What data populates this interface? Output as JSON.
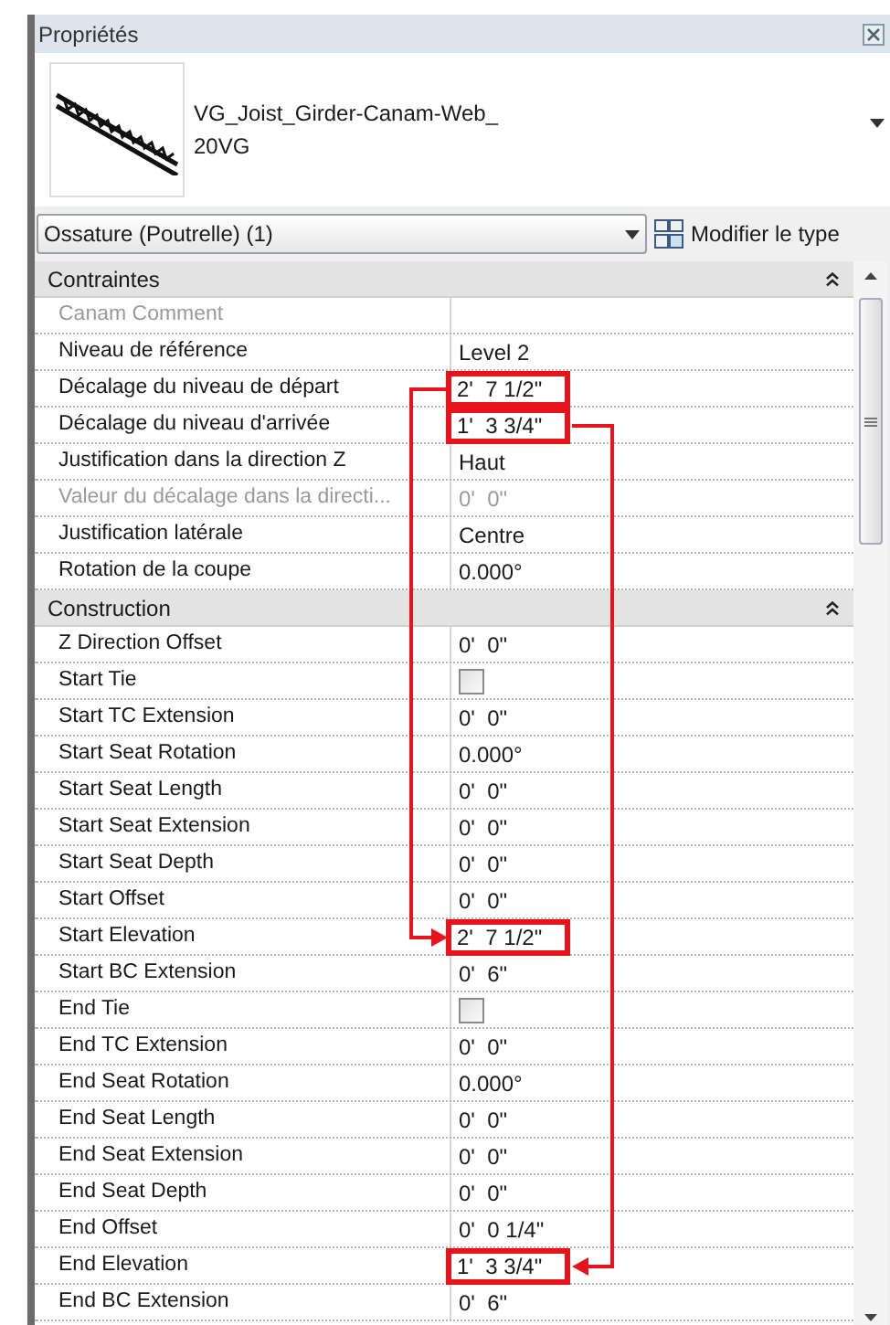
{
  "window": {
    "title": "Propriétés"
  },
  "type_selector": {
    "name_lines": [
      "VG_Joist_Girder-Canam-Web_",
      "20VG"
    ]
  },
  "instance_filter": {
    "value": "Ossature (Poutrelle) (1)"
  },
  "edit_type_button": {
    "label": "Modifier le type"
  },
  "sections": [
    {
      "title": "Contraintes",
      "expanded": true,
      "rows": [
        {
          "kind": "text",
          "label": "Canam Comment",
          "value": "",
          "disabled": true,
          "highlight": false
        },
        {
          "kind": "text",
          "label": "Niveau de référence",
          "value": "Level 2",
          "disabled": false,
          "highlight": false
        },
        {
          "kind": "text",
          "label": "Décalage du niveau de départ",
          "value": "2'  7 1/2\"",
          "disabled": false,
          "highlight": true
        },
        {
          "kind": "text",
          "label": "Décalage du niveau d'arrivée",
          "value": "1'  3 3/4\"",
          "disabled": false,
          "highlight": true
        },
        {
          "kind": "text",
          "label": "Justification dans la direction Z",
          "value": "Haut",
          "disabled": false,
          "highlight": false
        },
        {
          "kind": "text",
          "label": "Valeur du décalage dans la directi...",
          "value": "0'  0\"",
          "disabled": true,
          "highlight": false
        },
        {
          "kind": "text",
          "label": "Justification latérale",
          "value": "Centre",
          "disabled": false,
          "highlight": false
        },
        {
          "kind": "text",
          "label": "Rotation de la coupe",
          "value": "0.000°",
          "disabled": false,
          "highlight": false
        }
      ]
    },
    {
      "title": "Construction",
      "expanded": true,
      "rows": [
        {
          "kind": "text",
          "label": "Z Direction Offset",
          "value": "0'  0\"",
          "disabled": false,
          "highlight": false
        },
        {
          "kind": "checkbox",
          "label": "Start Tie",
          "checked": false,
          "disabled": false,
          "highlight": false
        },
        {
          "kind": "text",
          "label": "Start TC Extension",
          "value": "0'  0\"",
          "disabled": false,
          "highlight": false
        },
        {
          "kind": "text",
          "label": "Start Seat Rotation",
          "value": "0.000°",
          "disabled": false,
          "highlight": false
        },
        {
          "kind": "text",
          "label": "Start Seat Length",
          "value": "0'  0\"",
          "disabled": false,
          "highlight": false
        },
        {
          "kind": "text",
          "label": "Start Seat Extension",
          "value": "0'  0\"",
          "disabled": false,
          "highlight": false
        },
        {
          "kind": "text",
          "label": "Start Seat Depth",
          "value": "0'  0\"",
          "disabled": false,
          "highlight": false
        },
        {
          "kind": "text",
          "label": "Start Offset",
          "value": "0'  0\"",
          "disabled": false,
          "highlight": false
        },
        {
          "kind": "text",
          "label": "Start Elevation",
          "value": "2'  7 1/2\"",
          "disabled": false,
          "highlight": true
        },
        {
          "kind": "text",
          "label": "Start BC Extension",
          "value": "0'  6\"",
          "disabled": false,
          "highlight": false
        },
        {
          "kind": "checkbox",
          "label": "End Tie",
          "checked": false,
          "disabled": false,
          "highlight": false
        },
        {
          "kind": "text",
          "label": "End TC Extension",
          "value": "0'  0\"",
          "disabled": false,
          "highlight": false
        },
        {
          "kind": "text",
          "label": "End Seat Rotation",
          "value": "0.000°",
          "disabled": false,
          "highlight": false
        },
        {
          "kind": "text",
          "label": "End Seat Length",
          "value": "0'  0\"",
          "disabled": false,
          "highlight": false
        },
        {
          "kind": "text",
          "label": "End Seat Extension",
          "value": "0'  0\"",
          "disabled": false,
          "highlight": false
        },
        {
          "kind": "text",
          "label": "End Seat Depth",
          "value": "0'  0\"",
          "disabled": false,
          "highlight": false
        },
        {
          "kind": "text",
          "label": "End Offset",
          "value": "0'  0 1/4\"",
          "disabled": false,
          "highlight": false
        },
        {
          "kind": "text",
          "label": "End Elevation",
          "value": "1'  3 3/4\"",
          "disabled": false,
          "highlight": true
        },
        {
          "kind": "text",
          "label": "End BC Extension",
          "value": "0'  6\"",
          "disabled": false,
          "highlight": false
        }
      ]
    }
  ]
}
